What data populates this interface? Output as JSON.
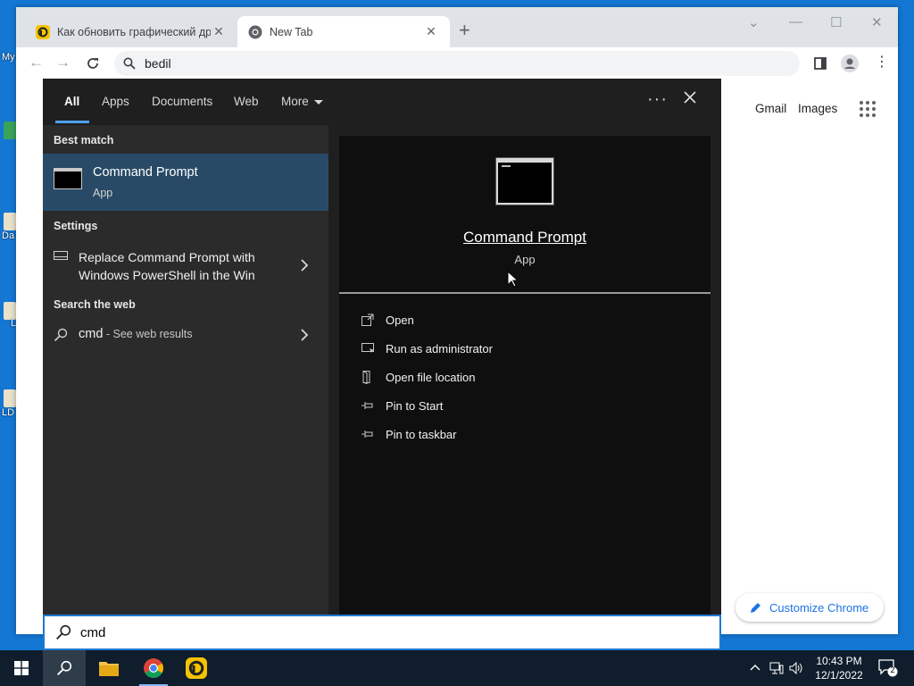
{
  "desktop": {
    "labels": [
      "My",
      "Da",
      "L",
      "LD"
    ]
  },
  "browser": {
    "tabs": [
      {
        "title": "Как обновить графический драйвер",
        "state": "inactive"
      },
      {
        "title": "New Tab",
        "state": "active"
      }
    ],
    "new_tab_symbol": "+",
    "window_controls": {
      "minimize": "—",
      "maximize": "☐",
      "close": "✕",
      "tab_search": "⌄"
    },
    "omnibox_text": "bedil",
    "ntp_links": {
      "gmail": "Gmail",
      "images": "Images"
    },
    "customize_label": "Customize Chrome"
  },
  "search_panel": {
    "scopes": [
      "All",
      "Apps",
      "Documents",
      "Web",
      "More"
    ],
    "active_scope": "All",
    "more_menu": "···",
    "sections": {
      "best_match": "Best match",
      "settings": "Settings",
      "search_web": "Search the web"
    },
    "best_match_item": {
      "name": "Command Prompt",
      "type": "App"
    },
    "settings_item": {
      "text": "Replace Command Prompt with Windows PowerShell in the Win"
    },
    "web_item": {
      "query": "cmd",
      "suffix": " - See web results"
    },
    "preview": {
      "name": "Command Prompt",
      "type": "App"
    },
    "actions": [
      {
        "label": "Open",
        "icon": "open-icon"
      },
      {
        "label": "Run as administrator",
        "icon": "shield-icon"
      },
      {
        "label": "Open file location",
        "icon": "file-location-icon"
      },
      {
        "label": "Pin to Start",
        "icon": "pin-icon"
      },
      {
        "label": "Pin to taskbar",
        "icon": "pin-icon"
      }
    ],
    "query": "cmd"
  },
  "taskbar": {
    "time": "10:43 PM",
    "date": "12/1/2022",
    "notification_count": "2",
    "colors": {
      "background": "#0f1d2c",
      "accent": "#1f78d1"
    }
  }
}
